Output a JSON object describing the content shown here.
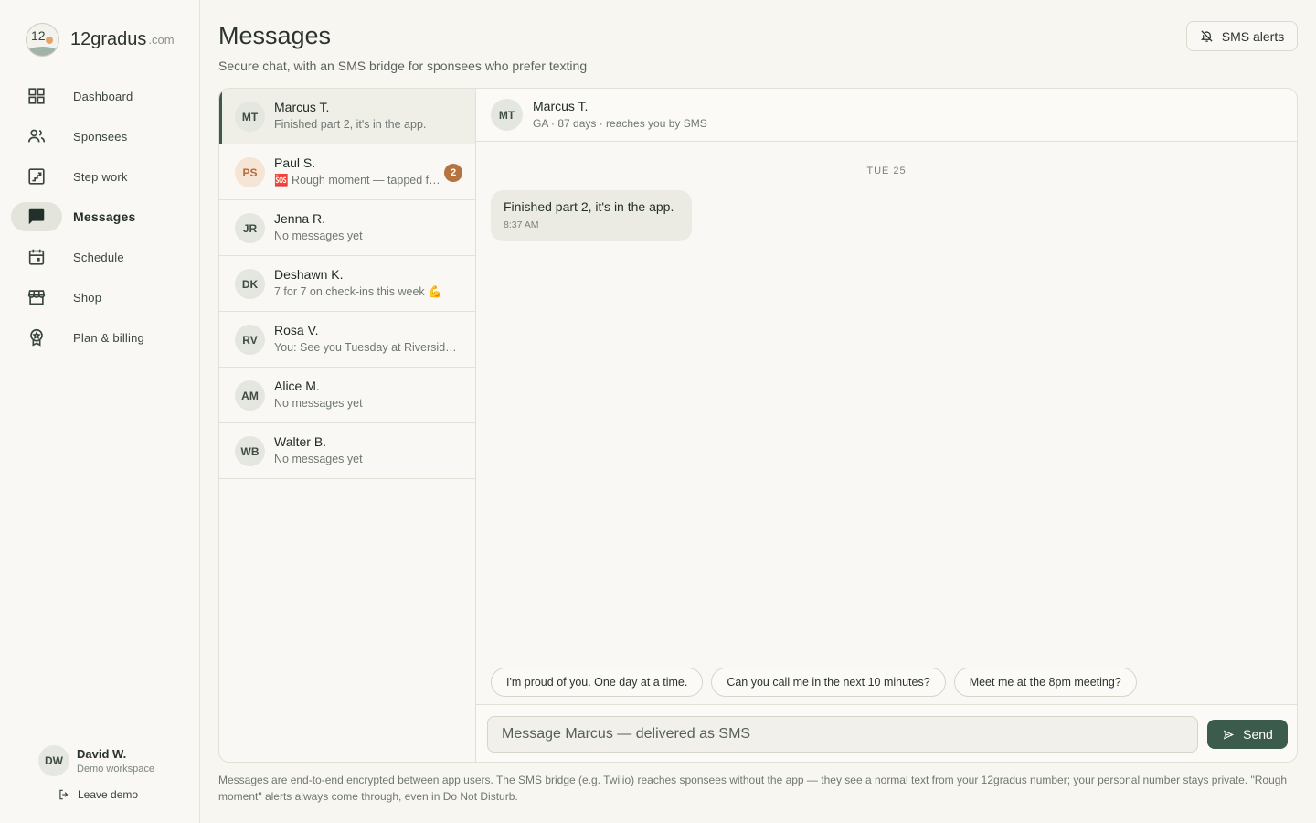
{
  "brand": {
    "logo_text": "12",
    "name": "12gradus",
    "tld": ".com"
  },
  "nav": [
    {
      "label": "Dashboard",
      "icon": "dashboard-icon",
      "active": false
    },
    {
      "label": "Sponsees",
      "icon": "people-icon",
      "active": false
    },
    {
      "label": "Step work",
      "icon": "stairs-icon",
      "active": false
    },
    {
      "label": "Messages",
      "icon": "chat-icon",
      "active": true
    },
    {
      "label": "Schedule",
      "icon": "calendar-icon",
      "active": false
    },
    {
      "label": "Shop",
      "icon": "store-icon",
      "active": false
    },
    {
      "label": "Plan & billing",
      "icon": "badge-icon",
      "active": false
    }
  ],
  "user": {
    "initials": "DW",
    "name": "David W.",
    "workspace": "Demo workspace",
    "leave_label": "Leave demo"
  },
  "header": {
    "title": "Messages",
    "subtitle": "Secure chat, with an SMS bridge for sponsees who prefer texting",
    "sms_alerts_label": "SMS alerts"
  },
  "conversations": [
    {
      "initials": "MT",
      "name": "Marcus T.",
      "preview": "Finished part 2, it's in the app.",
      "active": true,
      "badge": ""
    },
    {
      "initials": "PS",
      "name": "Paul S.",
      "preview": "🆘 Rough moment — tapped f…",
      "active": false,
      "badge": "2",
      "alert": true
    },
    {
      "initials": "JR",
      "name": "Jenna R.",
      "preview": "No messages yet",
      "active": false,
      "badge": ""
    },
    {
      "initials": "DK",
      "name": "Deshawn K.",
      "preview": "7 for 7 on check-ins this week 💪",
      "active": false,
      "badge": ""
    },
    {
      "initials": "RV",
      "name": "Rosa V.",
      "preview": "You: See you Tuesday at Riverside…",
      "active": false,
      "badge": ""
    },
    {
      "initials": "AM",
      "name": "Alice M.",
      "preview": "No messages yet",
      "active": false,
      "badge": ""
    },
    {
      "initials": "WB",
      "name": "Walter B.",
      "preview": "No messages yet",
      "active": false,
      "badge": ""
    }
  ],
  "chat": {
    "initials": "MT",
    "name": "Marcus T.",
    "meta": "GA · 87 days · reaches you by SMS",
    "day_label": "TUE 25",
    "messages": [
      {
        "text": "Finished part 2, it's in the app.",
        "time": "8:37 AM"
      }
    ],
    "quick_replies": [
      "I'm proud of you. One day at a time.",
      "Can you call me in the next 10 minutes?",
      "Meet me at the 8pm meeting?"
    ],
    "input_placeholder": "Message Marcus — delivered as SMS",
    "send_label": "Send"
  },
  "footnote": "Messages are end-to-end encrypted between app users. The SMS bridge (e.g. Twilio) reaches sponsees without the app — they see a normal text from your 12gradus number; your personal number stays private. \"Rough moment\" alerts always come through, even in Do Not Disturb.",
  "colors": {
    "accent": "#3b5b4c",
    "alert_badge": "#b6733f",
    "background": "#f7f6f1"
  }
}
